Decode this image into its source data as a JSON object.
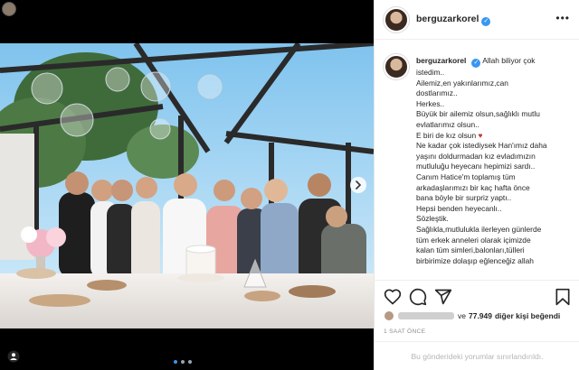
{
  "media": {
    "top_avatar": "avatar",
    "next_icon": "chevron-right-icon",
    "tag_icon": "person-tag-icon",
    "carousel": {
      "count": 3,
      "active_index": 0
    }
  },
  "post": {
    "username": "berguzarkorel",
    "verified": true,
    "caption_lines": [
      "Allah biliyor çok",
      "istedim..",
      "Ailemiz,en yakınlarımız,can",
      "dostlarımız..",
      "Herkes..",
      "Büyük bir ailemiz olsun,sağlıklı mutlu",
      "evlatlarımız olsun..",
      "E biri de kız olsun",
      "Ne kadar çok istediysek Han'ımız daha",
      "yaşını doldurmadan kız evladımızın",
      "mutluluğu heyecanı hepimizi sardı..",
      "Canım Hatice'm toplamış tüm",
      "arkadaşlarımızı bir kaç hafta önce",
      "bana böyle bir surpriz yaptı..",
      "Hepsi benden heyecanlı..",
      "Sözleştik.",
      "Sağlıkla,mutlulukla ilerleyen günlerde",
      "tüm erkek anneleri olarak içimizde",
      "kalan tüm simleri,balonları,tülleri",
      "birbirimize dolaşıp eğlenceğiz allah"
    ],
    "likes_prefix": "ve",
    "likes_count": "77.949",
    "likes_suffix": "diğer kişi beğendi",
    "time_ago": "1 SAAT ÖNCE",
    "comments_disabled": "Bu gönderideki yorumlar sınırlandırıldı.",
    "more_label": "•••"
  },
  "colors": {
    "accent": "#3897f0",
    "text": "#262626",
    "muted": "#8e8e8e"
  }
}
